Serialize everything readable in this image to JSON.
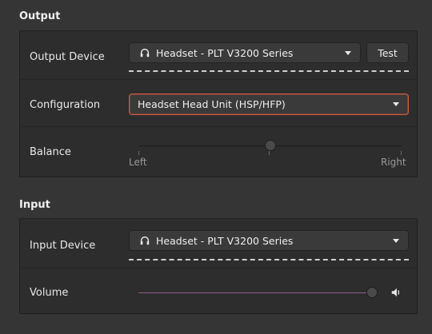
{
  "output": {
    "title": "Output",
    "device_label": "Output Device",
    "device_value": "Headset - PLT V3200 Series",
    "test_label": "Test",
    "config_label": "Configuration",
    "config_value": "Headset Head Unit (HSP/HFP)",
    "balance_label": "Balance",
    "balance_left": "Left",
    "balance_right": "Right",
    "balance_level": 0.5
  },
  "input": {
    "title": "Input",
    "device_label": "Input Device",
    "device_value": "Headset - PLT V3200 Series",
    "volume_label": "Volume",
    "volume_level": 1.0
  },
  "icons": {
    "device_icon": "headset-icon",
    "volume_icon": "speaker-volume-icon",
    "dropdown_icon": "chevron-down-icon"
  },
  "colors": {
    "accent_focus": "#d15a3c",
    "volume_fill": "#8e5a8c"
  }
}
